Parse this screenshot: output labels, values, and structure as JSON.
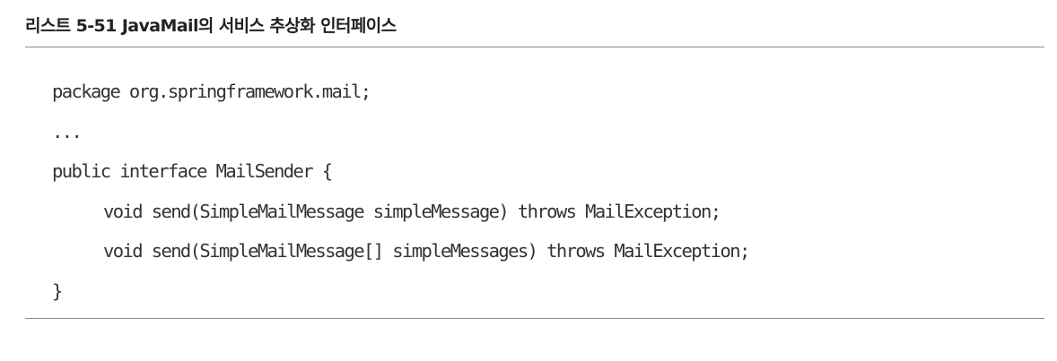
{
  "listing": {
    "caption": "리스트 5-51 JavaMail의 서비스 추상화 인터페이스",
    "code_lines": [
      "package org.springframework.mail;",
      "...",
      "public interface MailSender {",
      "void send(SimpleMailMessage simpleMessage) throws MailException;",
      "void send(SimpleMailMessage[] simpleMessages) throws MailException;",
      "}"
    ]
  }
}
